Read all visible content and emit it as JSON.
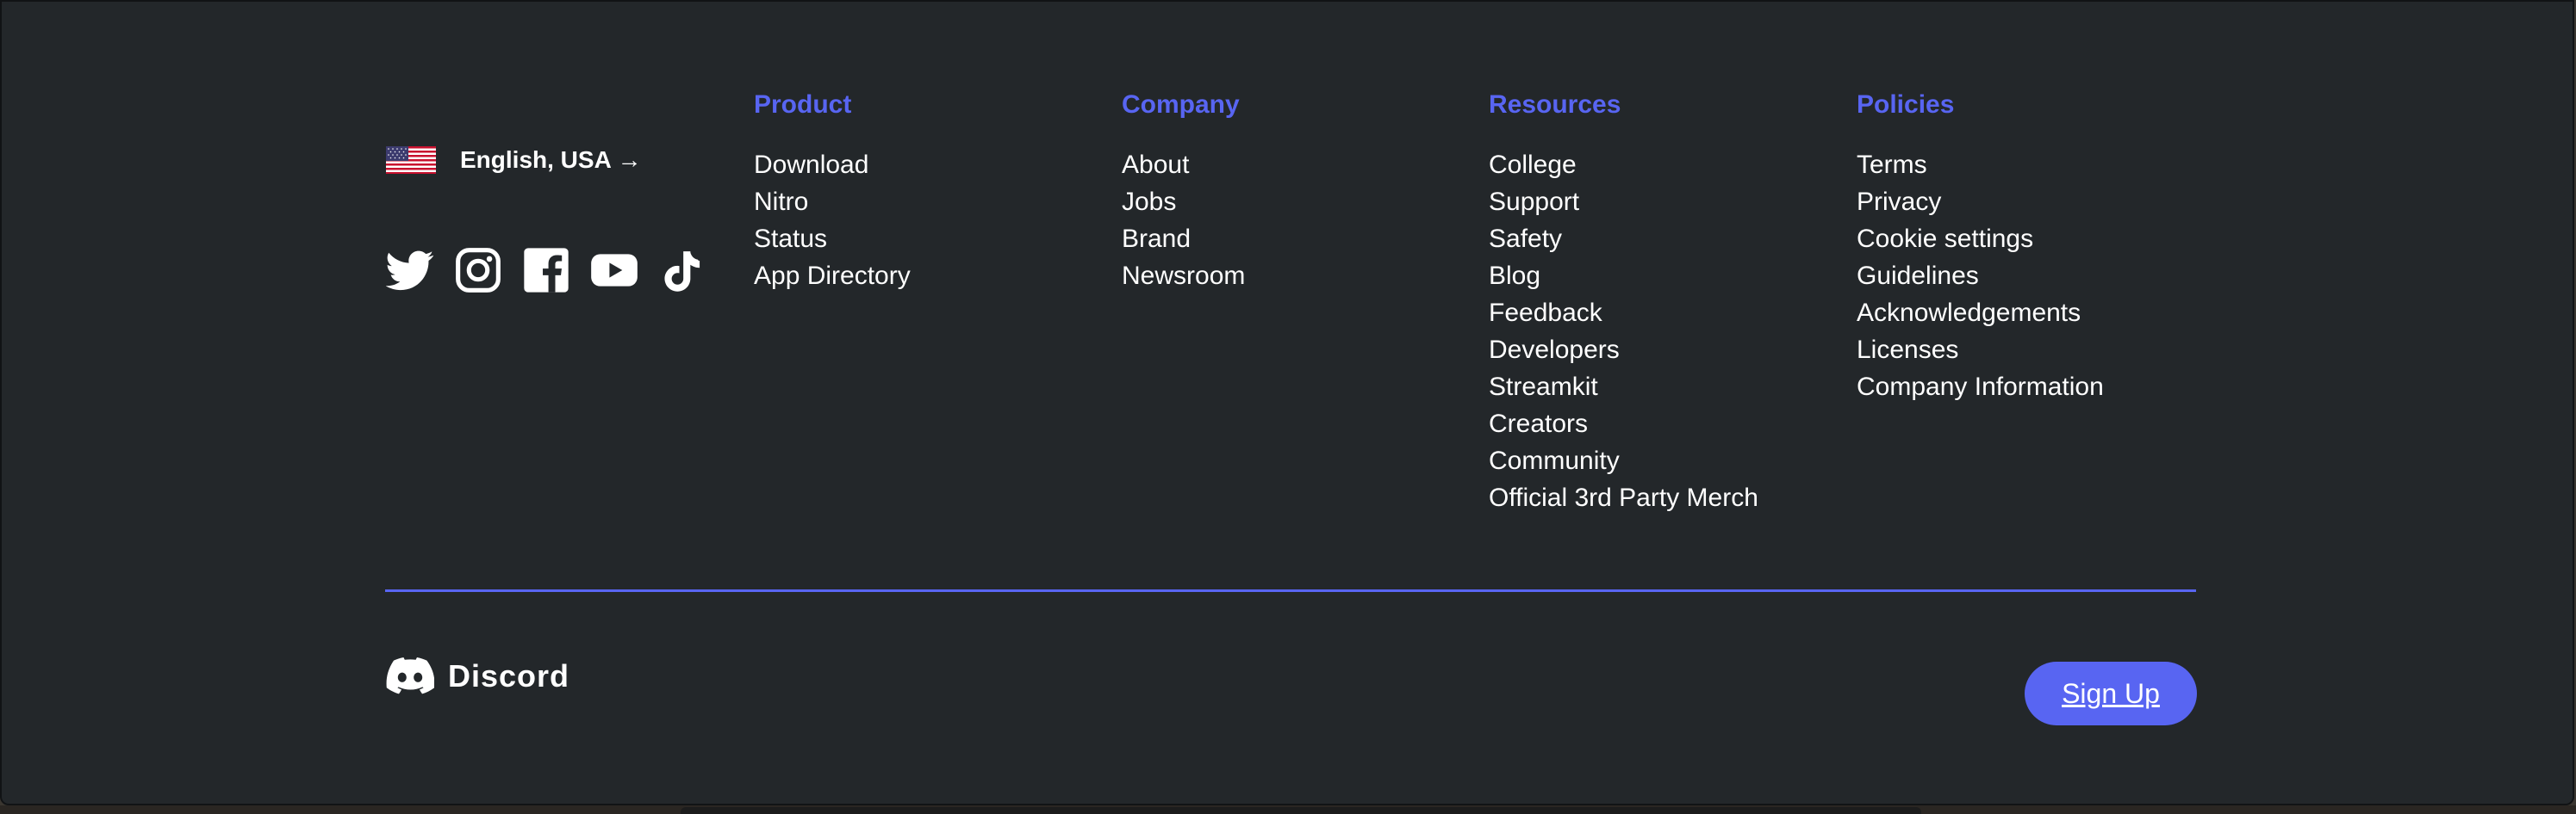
{
  "language": {
    "label": "English, USA →",
    "flag": "us-flag-icon"
  },
  "social": [
    {
      "name": "twitter-icon"
    },
    {
      "name": "instagram-icon"
    },
    {
      "name": "facebook-icon"
    },
    {
      "name": "youtube-icon"
    },
    {
      "name": "tiktok-icon"
    }
  ],
  "columns": [
    {
      "title": "Product",
      "links": [
        "Download",
        "Nitro",
        "Status",
        "App Directory"
      ]
    },
    {
      "title": "Company",
      "links": [
        "About",
        "Jobs",
        "Brand",
        "Newsroom"
      ]
    },
    {
      "title": "Resources",
      "links": [
        "College",
        "Support",
        "Safety",
        "Blog",
        "Feedback",
        "Developers",
        "Streamkit",
        "Creators",
        "Community",
        "Official 3rd Party Merch"
      ]
    },
    {
      "title": "Policies",
      "links": [
        "Terms",
        "Privacy",
        "Cookie settings",
        "Guidelines",
        "Acknowledgements",
        "Licenses",
        "Company Information"
      ]
    }
  ],
  "brand": {
    "name": "Discord"
  },
  "signup": {
    "label": "Sign Up"
  },
  "colors": {
    "accent": "#5865f2",
    "background": "#23272a",
    "text": "#ffffff"
  }
}
